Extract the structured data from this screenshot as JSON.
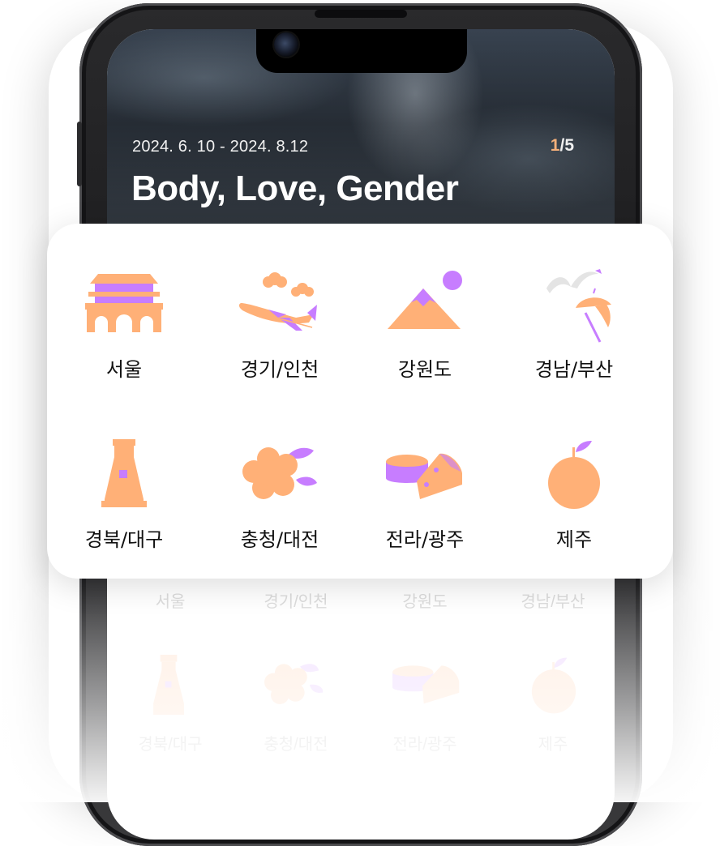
{
  "hero": {
    "date_range": "2024. 6. 10 - 2024. 8.12",
    "counter_current": "1",
    "counter_total": "/5",
    "title": "Body, Love, Gender"
  },
  "regions": [
    {
      "label": "서울",
      "icon": "palace-gate-icon"
    },
    {
      "label": "경기/인천",
      "icon": "airplane-clouds-icon"
    },
    {
      "label": "강원도",
      "icon": "mountain-sun-icon"
    },
    {
      "label": "경남/부산",
      "icon": "seagull-parasol-icon"
    },
    {
      "label": "경북/대구",
      "icon": "bottle-icon"
    },
    {
      "label": "충청/대전",
      "icon": "flower-icon"
    },
    {
      "label": "전라/광주",
      "icon": "cheese-icon"
    },
    {
      "label": "제주",
      "icon": "tangerine-icon"
    }
  ],
  "colors": {
    "orange": "#FFB077",
    "purple": "#C77DFF",
    "gray": "#E4E4E4"
  }
}
